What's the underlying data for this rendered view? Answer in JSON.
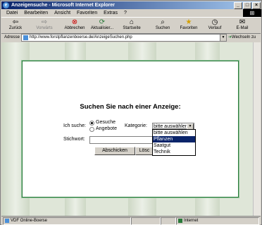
{
  "window": {
    "title": "Anzeigensuche - Microsoft Internet Explorer"
  },
  "menu": [
    "Datei",
    "Bearbeiten",
    "Ansicht",
    "Favoriten",
    "Extras",
    "?"
  ],
  "toolbar": {
    "back": "Zurück",
    "forward": "Vorwärts",
    "stop": "Abbrechen",
    "refresh": "Aktualisier...",
    "home": "Startseite",
    "search": "Suchen",
    "favorites": "Favoriten",
    "history": "Verlauf",
    "mail": "E-Mail"
  },
  "address": {
    "label": "Adresse",
    "url": "http://www.forstpflanzenboerse.de/AnzeigeSuchen.php",
    "go": "Wechseln zu"
  },
  "form": {
    "heading": "Suchen Sie nach einer Anzeige:",
    "ichsuche_label": "Ich suche:",
    "radio_gesuche": "Gesuche",
    "radio_angebote": "Angebote",
    "kategorie_label": "Kategorie:",
    "kategorie_value": "bitte auswählen",
    "options": [
      "bitte auswählen",
      "Pflanzen",
      "Saatgut",
      "Technik"
    ],
    "highlighted_option": "Pflanzen",
    "stichwort_label": "Stichwort:",
    "stichwort_value": "",
    "submit": "Abschicken",
    "reset": "Lösc"
  },
  "status": {
    "left": "VDF Online-Boerse",
    "zone": "Internet"
  },
  "colors": {
    "title_start": "#0a246a",
    "panel_border": "#2a7a3a",
    "highlight": "#0a246a"
  }
}
